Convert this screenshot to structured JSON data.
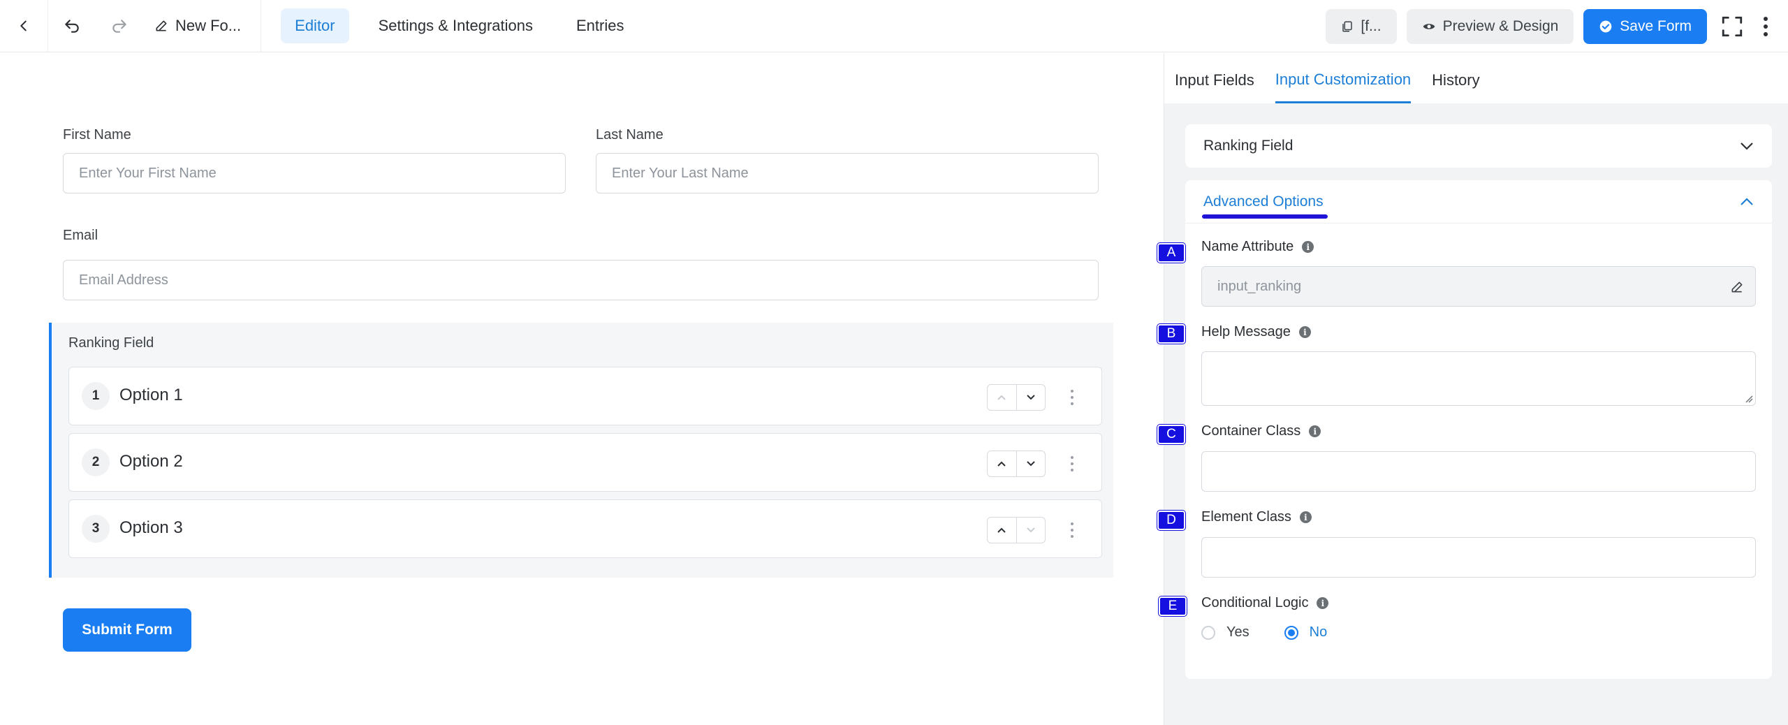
{
  "topbar": {
    "form_title": "New Fo...",
    "tabs": [
      {
        "label": "Editor",
        "active": true
      },
      {
        "label": "Settings & Integrations",
        "active": false
      },
      {
        "label": "Entries",
        "active": false
      }
    ],
    "shortcode_label": "[f...",
    "preview_label": "Preview & Design",
    "save_label": "Save Form"
  },
  "form": {
    "first_name": {
      "label": "First Name",
      "placeholder": "Enter Your First Name"
    },
    "last_name": {
      "label": "Last Name",
      "placeholder": "Enter Your Last Name"
    },
    "email": {
      "label": "Email",
      "placeholder": "Email Address"
    },
    "ranking": {
      "title": "Ranking Field",
      "options": [
        {
          "num": "1",
          "label": "Option 1"
        },
        {
          "num": "2",
          "label": "Option 2"
        },
        {
          "num": "3",
          "label": "Option 3"
        }
      ]
    },
    "submit_label": "Submit Form"
  },
  "panel": {
    "tabs": [
      {
        "label": "Input Fields",
        "active": false
      },
      {
        "label": "Input Customization",
        "active": true
      },
      {
        "label": "History",
        "active": false
      }
    ],
    "field_card_title": "Ranking Field",
    "advanced_title": "Advanced Options",
    "name_attribute": {
      "badge": "A",
      "label": "Name Attribute",
      "value": "input_ranking"
    },
    "help_message": {
      "badge": "B",
      "label": "Help Message",
      "value": ""
    },
    "container_class": {
      "badge": "C",
      "label": "Container Class",
      "value": ""
    },
    "element_class": {
      "badge": "D",
      "label": "Element Class",
      "value": ""
    },
    "conditional_logic": {
      "badge": "E",
      "label": "Conditional Logic",
      "options": [
        "Yes",
        "No"
      ],
      "selected": "No"
    }
  },
  "colors": {
    "accent": "#1a7ef2",
    "badge": "#1510e0",
    "panel_bg": "#f2f3f5"
  }
}
